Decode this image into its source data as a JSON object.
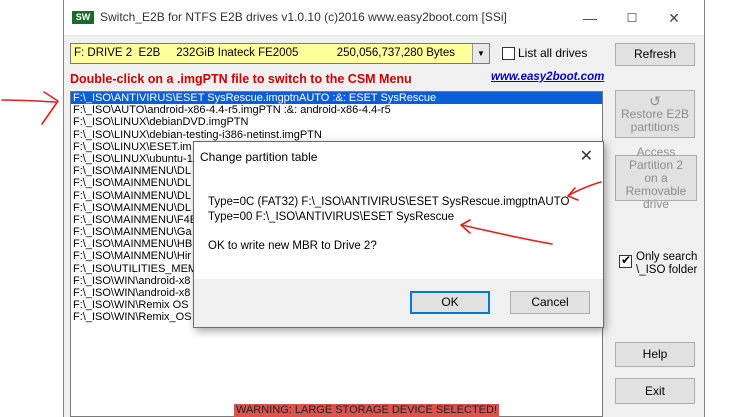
{
  "window": {
    "icon_text": "SW",
    "title": "Switch_E2B  for NTFS E2B drives   v1.0.10  (c)2016 www.easy2boot.com [SSi]",
    "minimize_glyph": "—",
    "maximize_glyph": "☐",
    "close_glyph": "✕"
  },
  "drive": {
    "selected": "F: DRIVE 2  E2B     232GiB Inateck FE2005            250,056,737,280 Bytes",
    "arrow_glyph": "▼"
  },
  "list_all": {
    "label": "List all drives",
    "checked": false
  },
  "hint": "Double-click on a .imgPTN file to switch to the CSM Menu",
  "site_link": "www.easy2boot.com",
  "files": [
    "F:\\_ISO\\ANTIVIRUS\\ESET SysRescue.imgptnAUTO :&: ESET SysRescue",
    "F:\\_ISO\\AUTO\\android-x86-4.4-r5.imgPTN :&: android-x86-4.4-r5",
    "F:\\_ISO\\LINUX\\debianDVD.imgPTN",
    "F:\\_ISO\\LINUX\\debian-testing-i386-netinst.imgPTN",
    "F:\\_ISO\\LINUX\\ESET.im",
    "F:\\_ISO\\LINUX\\ubuntu-1",
    "F:\\_ISO\\MAINMENU\\DL",
    "F:\\_ISO\\MAINMENU\\DL",
    "F:\\_ISO\\MAINMENU\\DL",
    "F:\\_ISO\\MAINMENU\\DL",
    "F:\\_ISO\\MAINMENU\\F4E",
    "F:\\_ISO\\MAINMENU\\Ga",
    "F:\\_ISO\\MAINMENU\\HB",
    "F:\\_ISO\\MAINMENU\\Hir",
    "F:\\_ISO\\UTILITIES_MEM",
    "F:\\_ISO\\WIN\\android-x8",
    "F:\\_ISO\\WIN\\android-x8",
    "F:\\_ISO\\WIN\\Remix OS",
    "F:\\_ISO\\WIN\\Remix_OS"
  ],
  "buttons": {
    "refresh": "Refresh",
    "restore_line1": "Restore E2B",
    "restore_line2": "partitions",
    "access_line1": "Access Partition 2",
    "access_line2": "on a Removable",
    "access_line3": "drive",
    "help": "Help",
    "exit": "Exit"
  },
  "only_search": {
    "line1": "Only search",
    "line2": "\\_ISO folder",
    "checked": true
  },
  "warning": "WARNING: LARGE STORAGE DEVICE SELECTED!",
  "dialog": {
    "title": "Change partition table",
    "close_glyph": "✕",
    "line1": "Type=0C (FAT32)  F:\\_ISO\\ANTIVIRUS\\ESET SysRescue.imgptnAUTO",
    "line2": "Type=00  F:\\_ISO\\ANTIVIRUS\\ESET SysRescue",
    "question": "OK to write new MBR to Drive 2?",
    "ok": "OK",
    "cancel": "Cancel"
  },
  "annotation_color": "#e0201e",
  "selection_color": "#0a5fd6",
  "drive_bg_color": "#ffff9c",
  "hint_color": "#cc0000"
}
